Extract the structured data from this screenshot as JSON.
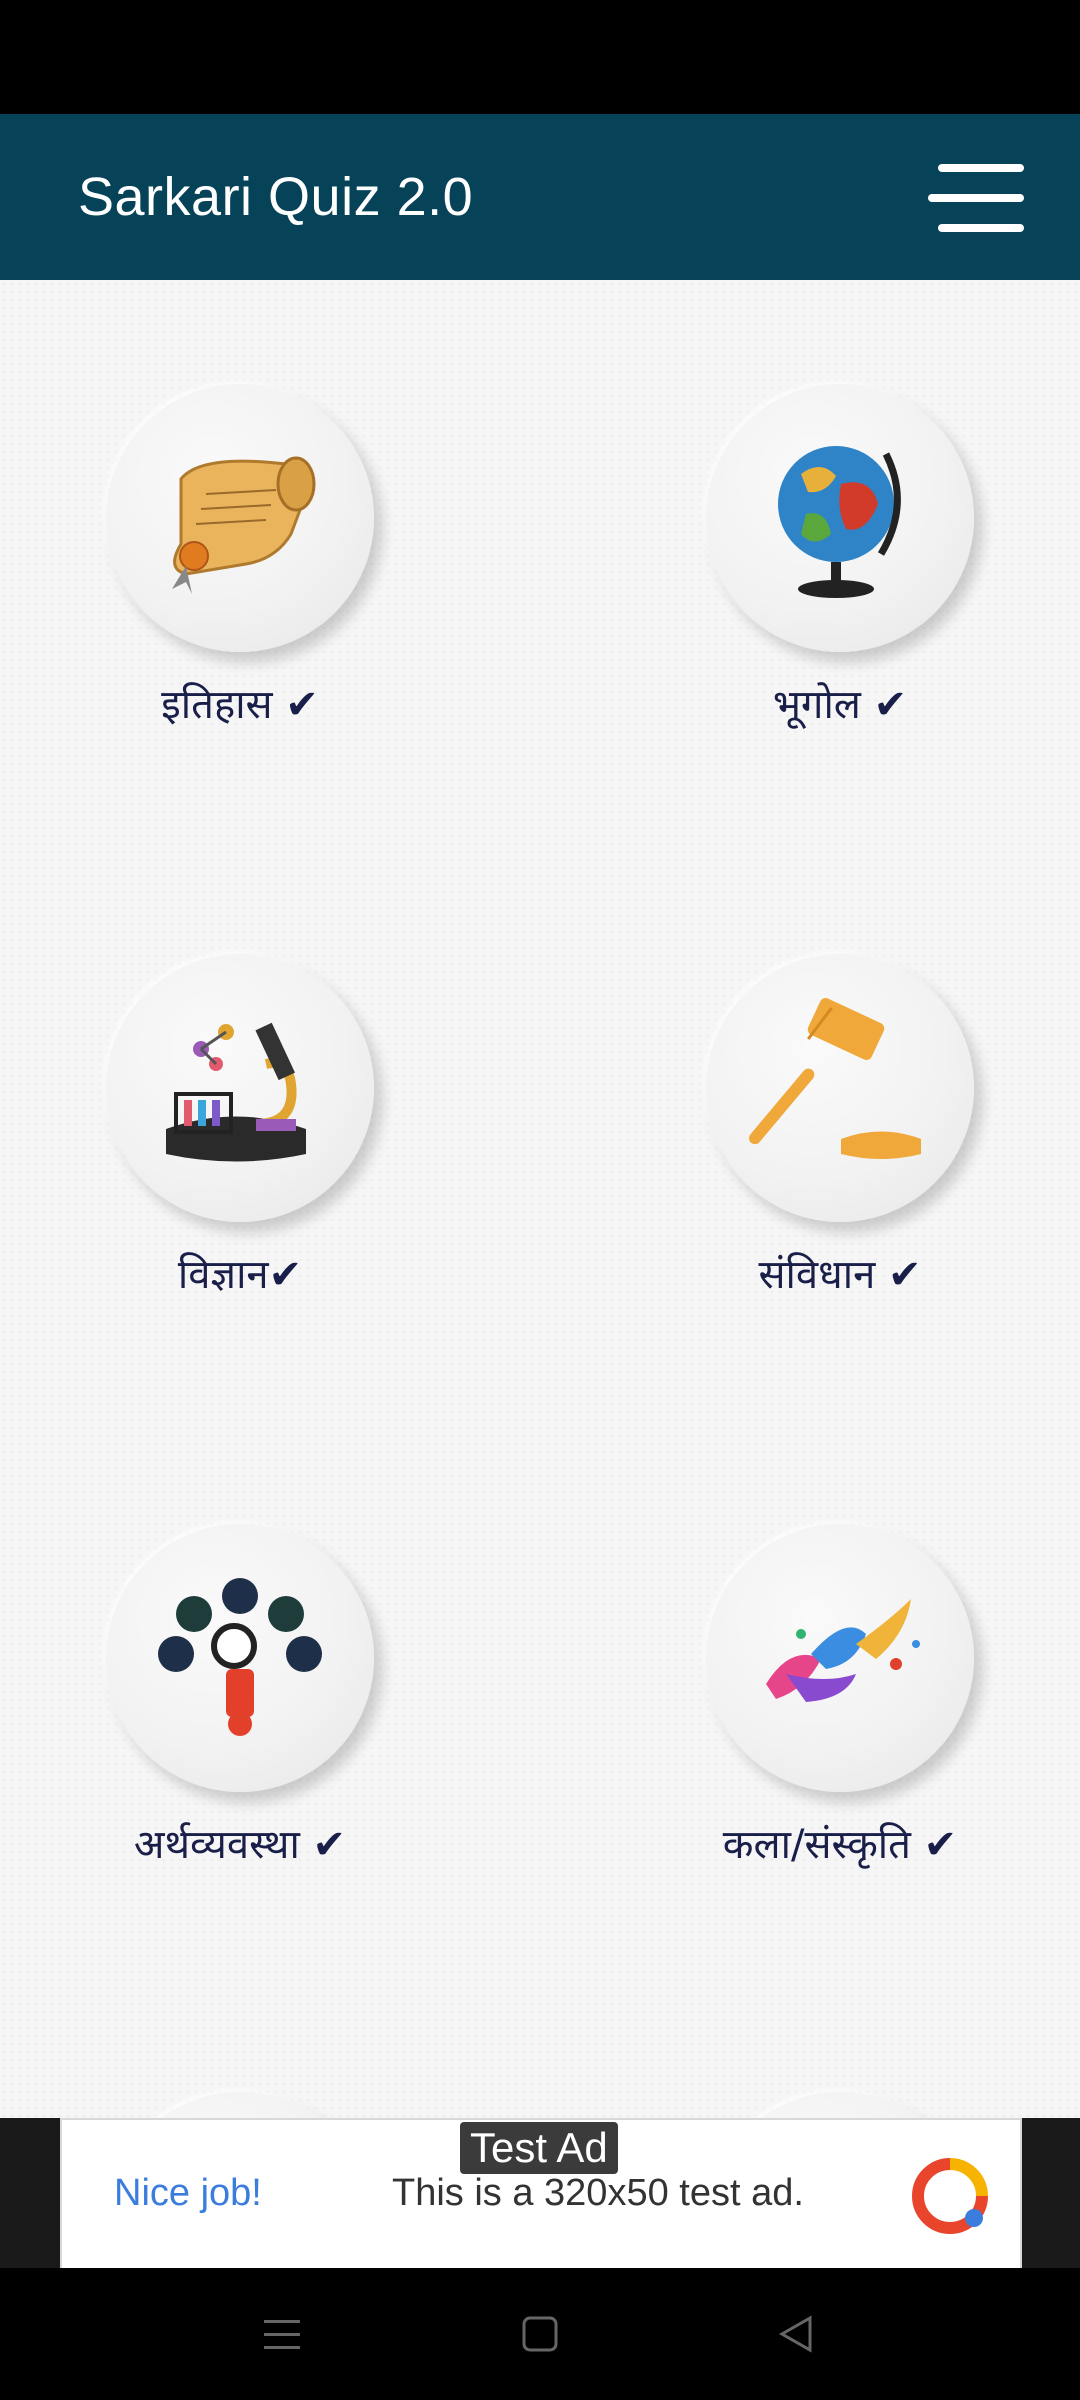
{
  "app": {
    "title": "Sarkari Quiz 2.0"
  },
  "categories": [
    {
      "label": "इतिहास ✔",
      "icon": "history-scroll-icon"
    },
    {
      "label": "भूगोल ✔",
      "icon": "globe-icon"
    },
    {
      "label": "विज्ञान✔",
      "icon": "science-lab-icon"
    },
    {
      "label": "संविधान ✔",
      "icon": "gavel-icon"
    },
    {
      "label": "अर्थव्यवस्था ✔",
      "icon": "economy-icon"
    },
    {
      "label": "कला/संस्कृति ✔",
      "icon": "art-dance-icon"
    }
  ],
  "ad": {
    "tag": "Test Ad",
    "headline": "Nice job!",
    "body": "This is a 320x50 test ad."
  },
  "colors": {
    "app_bar": "#064359",
    "label": "#1a1f4a"
  }
}
